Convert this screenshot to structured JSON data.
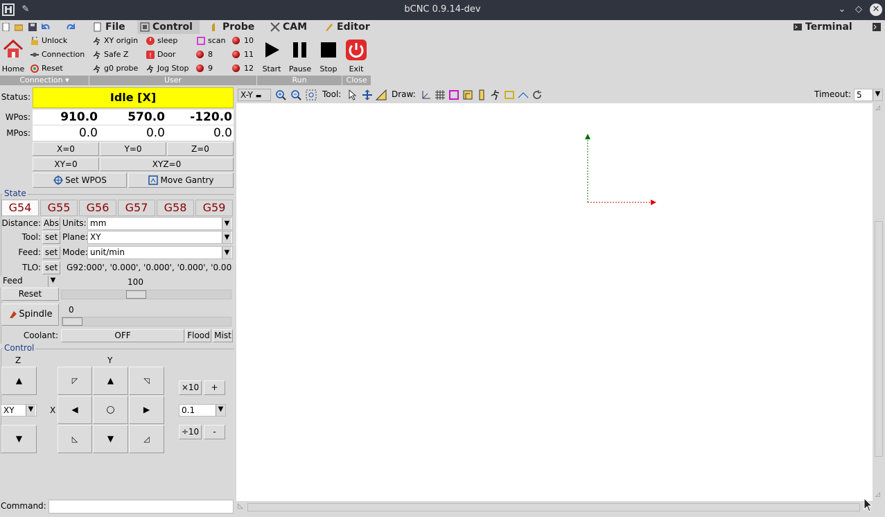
{
  "window": {
    "title": "bCNC 0.9.14-dev"
  },
  "tabs": [
    "File",
    "Control",
    "Probe",
    "CAM",
    "Editor",
    "Terminal"
  ],
  "ribbon": {
    "home": "Home",
    "connection_items": [
      "Unlock",
      "Connection",
      "Reset"
    ],
    "connection_group": "Connection",
    "user_col1": [
      "XY origin",
      "Safe Z",
      "g0 probe"
    ],
    "user_col2": [
      "sleep",
      "Door",
      "Jog Stop"
    ],
    "user_col3": [
      "scan",
      "8",
      "9"
    ],
    "user_col4": [
      "10",
      "11",
      "12"
    ],
    "user_group": "User",
    "run": [
      "Start",
      "Pause",
      "Stop"
    ],
    "run_group": "Run",
    "exit": "Exit",
    "close_group": "Close"
  },
  "status": {
    "label": "Status:",
    "value": "Idle [X]",
    "wpos_label": "WPos:",
    "mpos_label": "MPos:",
    "wpos": [
      "910.0",
      "570.0",
      "-120.0"
    ],
    "mpos": [
      "0.0",
      "0.0",
      "0.0"
    ],
    "zero_buttons": [
      "X=0",
      "Y=0",
      "Z=0"
    ],
    "xy_zero": "XY=0",
    "xyz_zero": "XYZ=0",
    "set_wpos": "Set WPOS",
    "move_gantry": "Move Gantry"
  },
  "state": {
    "title": "State",
    "wcs": [
      "G54",
      "G55",
      "G56",
      "G57",
      "G58",
      "G59"
    ],
    "distance_label": "Distance:",
    "distance_value": "Abs",
    "units_label": "Units:",
    "units_value": "mm",
    "tool_label": "Tool:",
    "set": "set",
    "plane_label": "Plane:",
    "plane_value": "XY",
    "feed_label": "Feed:",
    "mode_label": "Mode:",
    "mode_value": "unit/min",
    "tlo_label": "TLO:",
    "g92": "G92:000', '0.000', '0.000', '0.000', '0.00",
    "feed_select": "Feed",
    "feed_override": "100",
    "reset": "Reset",
    "spindle": "Spindle",
    "spindle_value": "0",
    "coolant_label": "Coolant:",
    "coolant_value": "OFF",
    "flood": "Flood",
    "mist": "Mist"
  },
  "control": {
    "title": "Control",
    "z_label": "Z",
    "y_label": "Y",
    "x_label": "X",
    "plane_select": "XY",
    "mult10": "×10",
    "plus": "+",
    "step": "0.1",
    "div10": "÷10",
    "minus": "-"
  },
  "canvas_toolbar": {
    "view": "X-Y",
    "tool_label": "Tool:",
    "draw_label": "Draw:",
    "timeout_label": "Timeout:",
    "timeout_value": "5"
  },
  "command": {
    "label": "Command:"
  },
  "colors": {
    "status_bg": "#ffff00",
    "wcs_text": "#8b0000",
    "axis_x": "#e00000",
    "axis_y": "#007000",
    "titlebar": "#2f343f"
  }
}
